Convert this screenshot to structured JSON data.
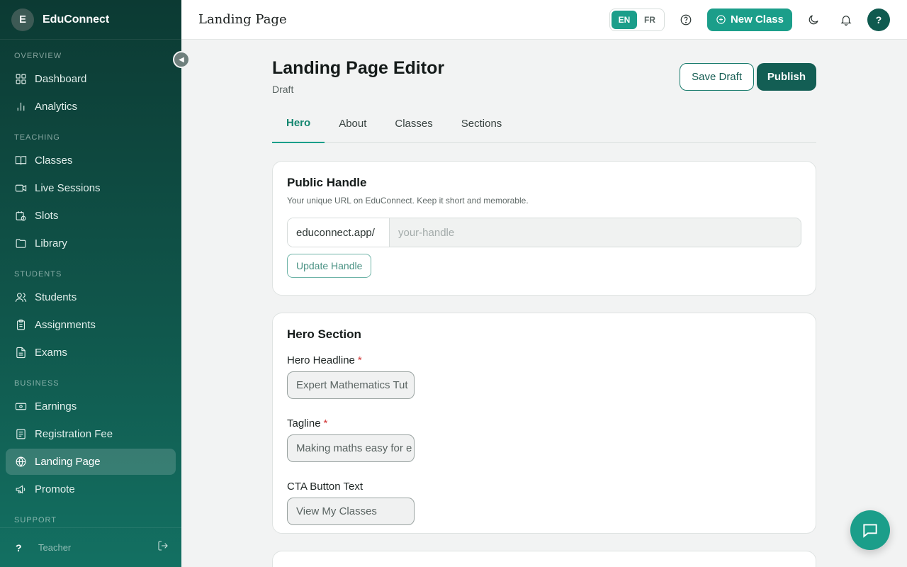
{
  "brand": {
    "initial": "E",
    "name": "EduConnect"
  },
  "sidebar": {
    "sections": [
      {
        "label": "OVERVIEW",
        "items": [
          {
            "label": "Dashboard",
            "icon": "dashboard-icon"
          },
          {
            "label": "Analytics",
            "icon": "analytics-icon"
          }
        ]
      },
      {
        "label": "TEACHING",
        "items": [
          {
            "label": "Classes",
            "icon": "book-icon"
          },
          {
            "label": "Live Sessions",
            "icon": "video-icon"
          },
          {
            "label": "Slots",
            "icon": "calendar-clock-icon"
          },
          {
            "label": "Library",
            "icon": "folder-icon"
          }
        ]
      },
      {
        "label": "STUDENTS",
        "items": [
          {
            "label": "Students",
            "icon": "users-icon"
          },
          {
            "label": "Assignments",
            "icon": "clipboard-icon"
          },
          {
            "label": "Exams",
            "icon": "file-icon"
          }
        ]
      },
      {
        "label": "BUSINESS",
        "items": [
          {
            "label": "Earnings",
            "icon": "money-icon"
          },
          {
            "label": "Registration Fee",
            "icon": "receipt-icon"
          },
          {
            "label": "Landing Page",
            "icon": "globe-icon",
            "active": true
          },
          {
            "label": "Promote",
            "icon": "megaphone-icon"
          }
        ]
      },
      {
        "label": "SUPPORT",
        "items": []
      }
    ],
    "footer": {
      "badge": "?",
      "role": "Teacher"
    }
  },
  "header": {
    "title": "Landing Page",
    "languages": [
      "EN",
      "FR"
    ],
    "active_language": "EN",
    "new_class_label": "New Class",
    "avatar": "?"
  },
  "page": {
    "title": "Landing Page Editor",
    "status": "Draft",
    "save_label": "Save Draft",
    "publish_label": "Publish",
    "tabs": [
      "Hero",
      "About",
      "Classes",
      "Sections"
    ],
    "active_tab": "Hero"
  },
  "public_handle": {
    "title": "Public Handle",
    "subtitle": "Your unique URL on EduConnect. Keep it short and memorable.",
    "prefix": "educonnect.app/",
    "placeholder": "your-handle",
    "value": "",
    "button_label": "Update Handle"
  },
  "hero": {
    "title": "Hero Section",
    "headline_label": "Hero Headline",
    "headline_value": "Expert Mathematics Tut",
    "tagline_label": "Tagline",
    "tagline_value": "Making maths easy for e",
    "cta_label": "CTA Button Text",
    "cta_value": "View My Classes",
    "required_mark": "*"
  },
  "colors": {
    "accent": "#1b9e8a",
    "dark_accent": "#135e54",
    "sidebar_top": "#0c3a33"
  }
}
